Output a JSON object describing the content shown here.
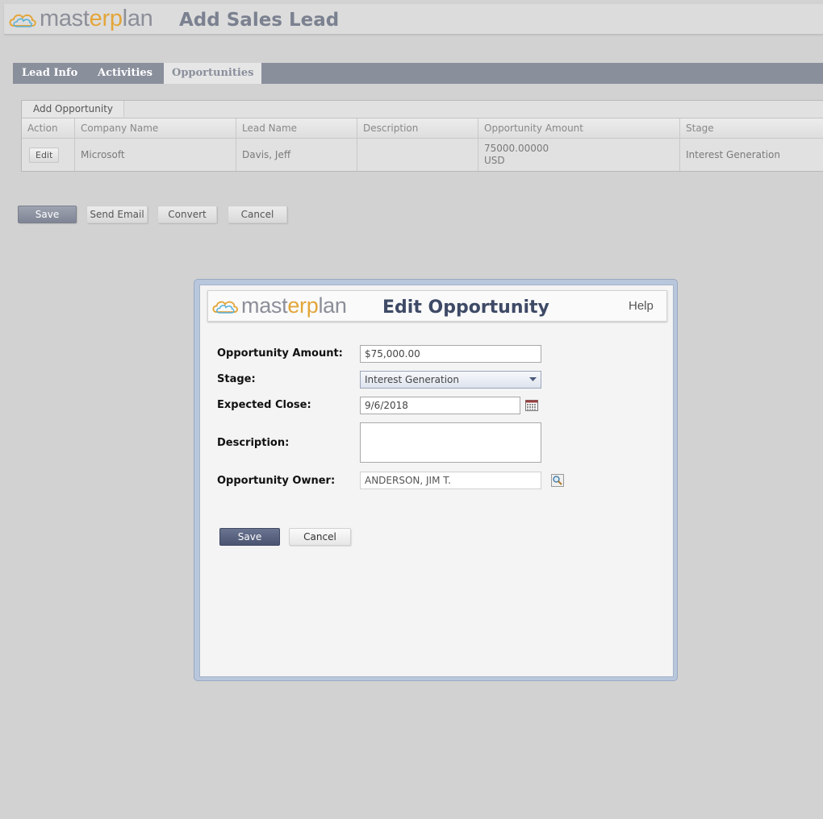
{
  "header": {
    "logo": {
      "part1": "mast",
      "accent": "erp",
      "part2": "lan"
    },
    "title": "Add Sales Lead"
  },
  "tabs": [
    {
      "label": "Lead Info"
    },
    {
      "label": "Activities"
    },
    {
      "label": "Opportunities",
      "active": true
    }
  ],
  "grid": {
    "add_label": "Add Opportunity",
    "columns": [
      "Action",
      "Company Name",
      "Lead Name",
      "Description",
      "Opportunity Amount",
      "Stage"
    ],
    "rows": [
      {
        "action": "Edit",
        "company": "Microsoft",
        "lead": "Davis, Jeff",
        "description": "",
        "amount": "75000.00000",
        "currency": "USD",
        "stage": "Interest Generation"
      }
    ]
  },
  "page_buttons": {
    "save": "Save",
    "send_email": "Send Email",
    "convert": "Convert",
    "cancel": "Cancel"
  },
  "modal": {
    "title": "Edit Opportunity",
    "help": "Help",
    "fields": {
      "amount_label": "Opportunity Amount:",
      "amount_value": "$75,000.00",
      "stage_label": "Stage:",
      "stage_value": "Interest Generation",
      "close_label": "Expected Close:",
      "close_value": "9/6/2018",
      "description_label": "Description:",
      "description_value": "",
      "owner_label": "Opportunity Owner:",
      "owner_value": "ANDERSON, JIM T."
    },
    "save": "Save",
    "cancel": "Cancel"
  },
  "icons": {
    "logo": "cloud-icon",
    "stage_dropdown": "chevron-down-icon",
    "close_picker": "calendar-icon",
    "owner_lookup": "magnifier-icon"
  },
  "colors": {
    "background": "#d2d2d2",
    "tab_bar": "#8a8f9c",
    "logo_gray": "#8c8f99",
    "logo_accent": "#e3a63a",
    "modal_title": "#3e4a66",
    "modal_border": "#b8c7dc",
    "primary_button": "#4b5572"
  }
}
